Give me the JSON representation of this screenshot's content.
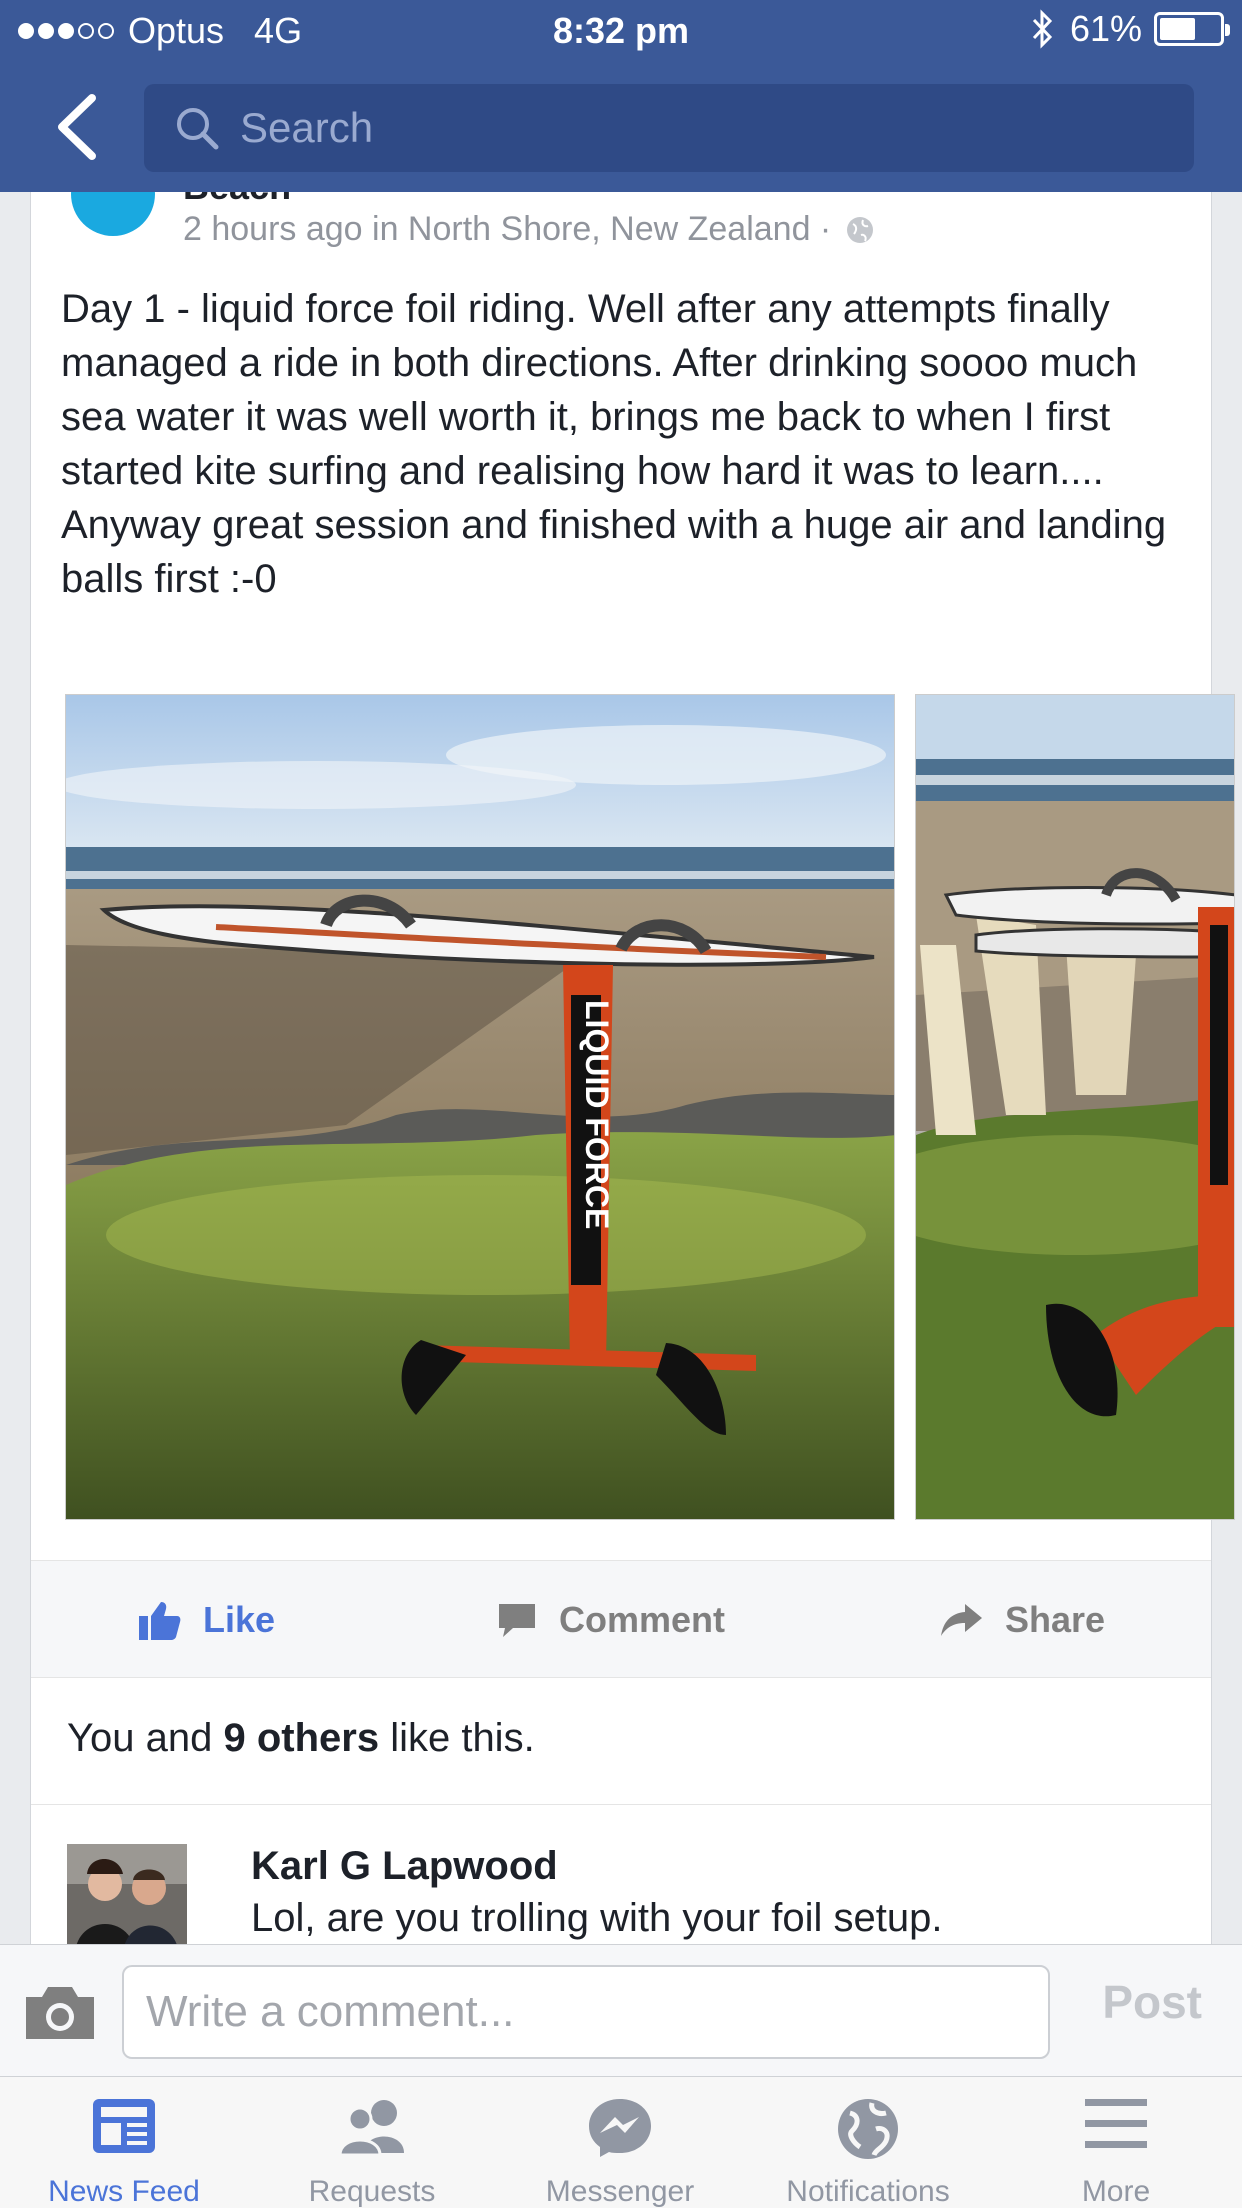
{
  "status_bar": {
    "carrier": "Optus",
    "network": "4G",
    "time": "8:32 pm",
    "battery": "61%",
    "battery_level": 0.61,
    "signal_bars": 3,
    "signal_max": 5
  },
  "nav": {
    "search_placeholder": "Search"
  },
  "post": {
    "author_partial": "Beach",
    "meta": "2 hours ago in North Shore, New Zealand ·",
    "text_lines": [
      "Day 1 - liquid force foil riding. Well after any attempts finally managed a ride in both directions. After drinking soooo much sea water it was well worth it, brings me back to when I first started kite surfing and realising how hard it was to learn....",
      "Anyway great session and finished with a huge air and landing balls first :-0"
    ],
    "photo_brand": "LIQUID FORCE"
  },
  "actions": {
    "like": "Like",
    "comment": "Comment",
    "share": "Share"
  },
  "likes": {
    "prefix": "You and ",
    "bold": "9 others",
    "suffix": " like this."
  },
  "comment": {
    "name": "Karl G Lapwood",
    "text": "Lol, are you trolling with your foil setup."
  },
  "composer": {
    "placeholder": "Write a comment...",
    "post_label": "Post"
  },
  "tabs": [
    {
      "label": "News Feed",
      "icon": "news-feed-icon",
      "active": true
    },
    {
      "label": "Requests",
      "icon": "friend-requests-icon",
      "active": false
    },
    {
      "label": "Messenger",
      "icon": "messenger-icon",
      "active": false
    },
    {
      "label": "Notifications",
      "icon": "globe-icon",
      "active": false
    },
    {
      "label": "More",
      "icon": "hamburger-icon",
      "active": false
    }
  ],
  "colors": {
    "brand": "#3b5998",
    "accent": "#4b74d8"
  }
}
